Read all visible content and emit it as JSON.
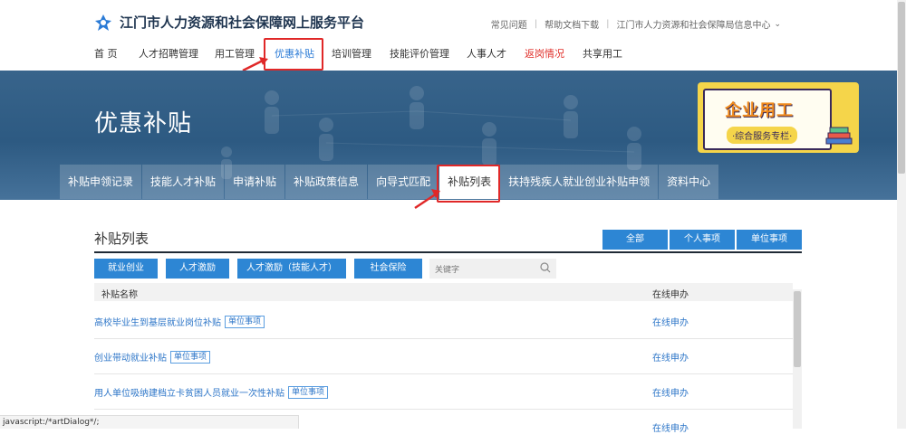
{
  "header": {
    "site_title": "江门市人力资源和社会保障网上服务平台",
    "links": [
      "常见问题",
      "帮助文档下载",
      "江门市人力资源和社会保障局信息中心"
    ]
  },
  "nav": {
    "items": [
      {
        "label": "首 页"
      },
      {
        "label": "人才招聘管理"
      },
      {
        "label": "用工管理"
      },
      {
        "label": "优惠补贴",
        "active": true
      },
      {
        "label": "培训管理"
      },
      {
        "label": "技能评价管理"
      },
      {
        "label": "人事人才"
      },
      {
        "label": "返岗情况",
        "color": "#e0302b"
      },
      {
        "label": "共享用工"
      }
    ]
  },
  "banner": {
    "title": "优惠补贴",
    "promo_title": "企业用工",
    "promo_subtitle": "·综合服务专栏·"
  },
  "tabs": [
    {
      "label": "补贴申领记录"
    },
    {
      "label": "技能人才补贴"
    },
    {
      "label": "申请补贴"
    },
    {
      "label": "补贴政策信息"
    },
    {
      "label": "向导式匹配"
    },
    {
      "label": "补贴列表",
      "active": true
    },
    {
      "label": "扶持残疾人就业创业补贴申领"
    },
    {
      "label": "资料中心"
    }
  ],
  "list": {
    "title": "补贴列表",
    "filters": [
      "全部",
      "个人事项",
      "单位事项"
    ],
    "categories": [
      "就业创业",
      "人才激励",
      "人才激励（技能人才）",
      "社会保险"
    ],
    "search_placeholder": "关键字",
    "col_name": "补贴名称",
    "col_action": "在线申办",
    "rows": [
      {
        "name": "高校毕业生到基层就业岗位补贴",
        "tag": "单位事项",
        "action": "在线申办"
      },
      {
        "name": "创业带动就业补贴",
        "tag": "单位事项",
        "action": "在线申办"
      },
      {
        "name": "用人单位吸纳建档立卡贫困人员就业一次性补贴",
        "tag": "单位事项",
        "action": "在线申办"
      },
      {
        "name": "",
        "tag": "",
        "action": "在线申办"
      }
    ]
  },
  "status_bar": "javascript:/*artDialog*/;",
  "colors": {
    "accent": "#2d86d4",
    "highlight": "#e02828",
    "banner": "#2d5a82"
  }
}
